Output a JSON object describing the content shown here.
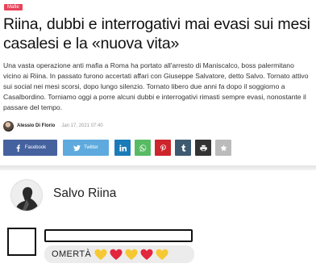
{
  "article": {
    "category": "Mafie",
    "headline": "Riina, dubbi e interrogativi mai evasi sui mesi casalesi e la «nuova vita»",
    "summary": "Una vasta operazione anti mafia a Roma ha portato all'arresto di Maniscalco, boss palermitano vicino ai Riina. In passato furono accertati affari con Giuseppe Salvatore, detto Salvo. Tornato attivo sui social nei mesi scorsi, dopo lungo silenzio. Tornato libero due anni fa dopo il soggiorno a Casalbordino. Torniamo oggi a porre alcuni dubbi e interrogativi rimasti sempre evasi, nonostante il passare del tempo.",
    "author": "Alessio Di Florio",
    "date": "Jan 17, 2021 07:40"
  },
  "share": {
    "facebook_label": "Facebook",
    "twitter_label": "Twitter",
    "icons": [
      "facebook-icon",
      "twitter-icon",
      "linkedin-icon",
      "whatsapp-icon",
      "pinterest-icon",
      "tumblr-icon",
      "print-icon",
      "star-icon"
    ],
    "colors": {
      "facebook": "#45629f",
      "twitter": "#5eaade",
      "linkedin": "#1a7bb9",
      "whatsapp": "#57bb63",
      "pinterest": "#cd252b",
      "tumblr": "#3e5a70",
      "print": "#333333",
      "star": "#bbbbbb"
    }
  },
  "embed": {
    "profile_name": "Salvo Riina",
    "comment_text": "OMERTÀ",
    "comment_emojis": [
      "yellow-heart",
      "red-heart",
      "yellow-heart",
      "red-heart",
      "yellow-heart"
    ]
  },
  "colors": {
    "category_tag": "#e8435a"
  }
}
